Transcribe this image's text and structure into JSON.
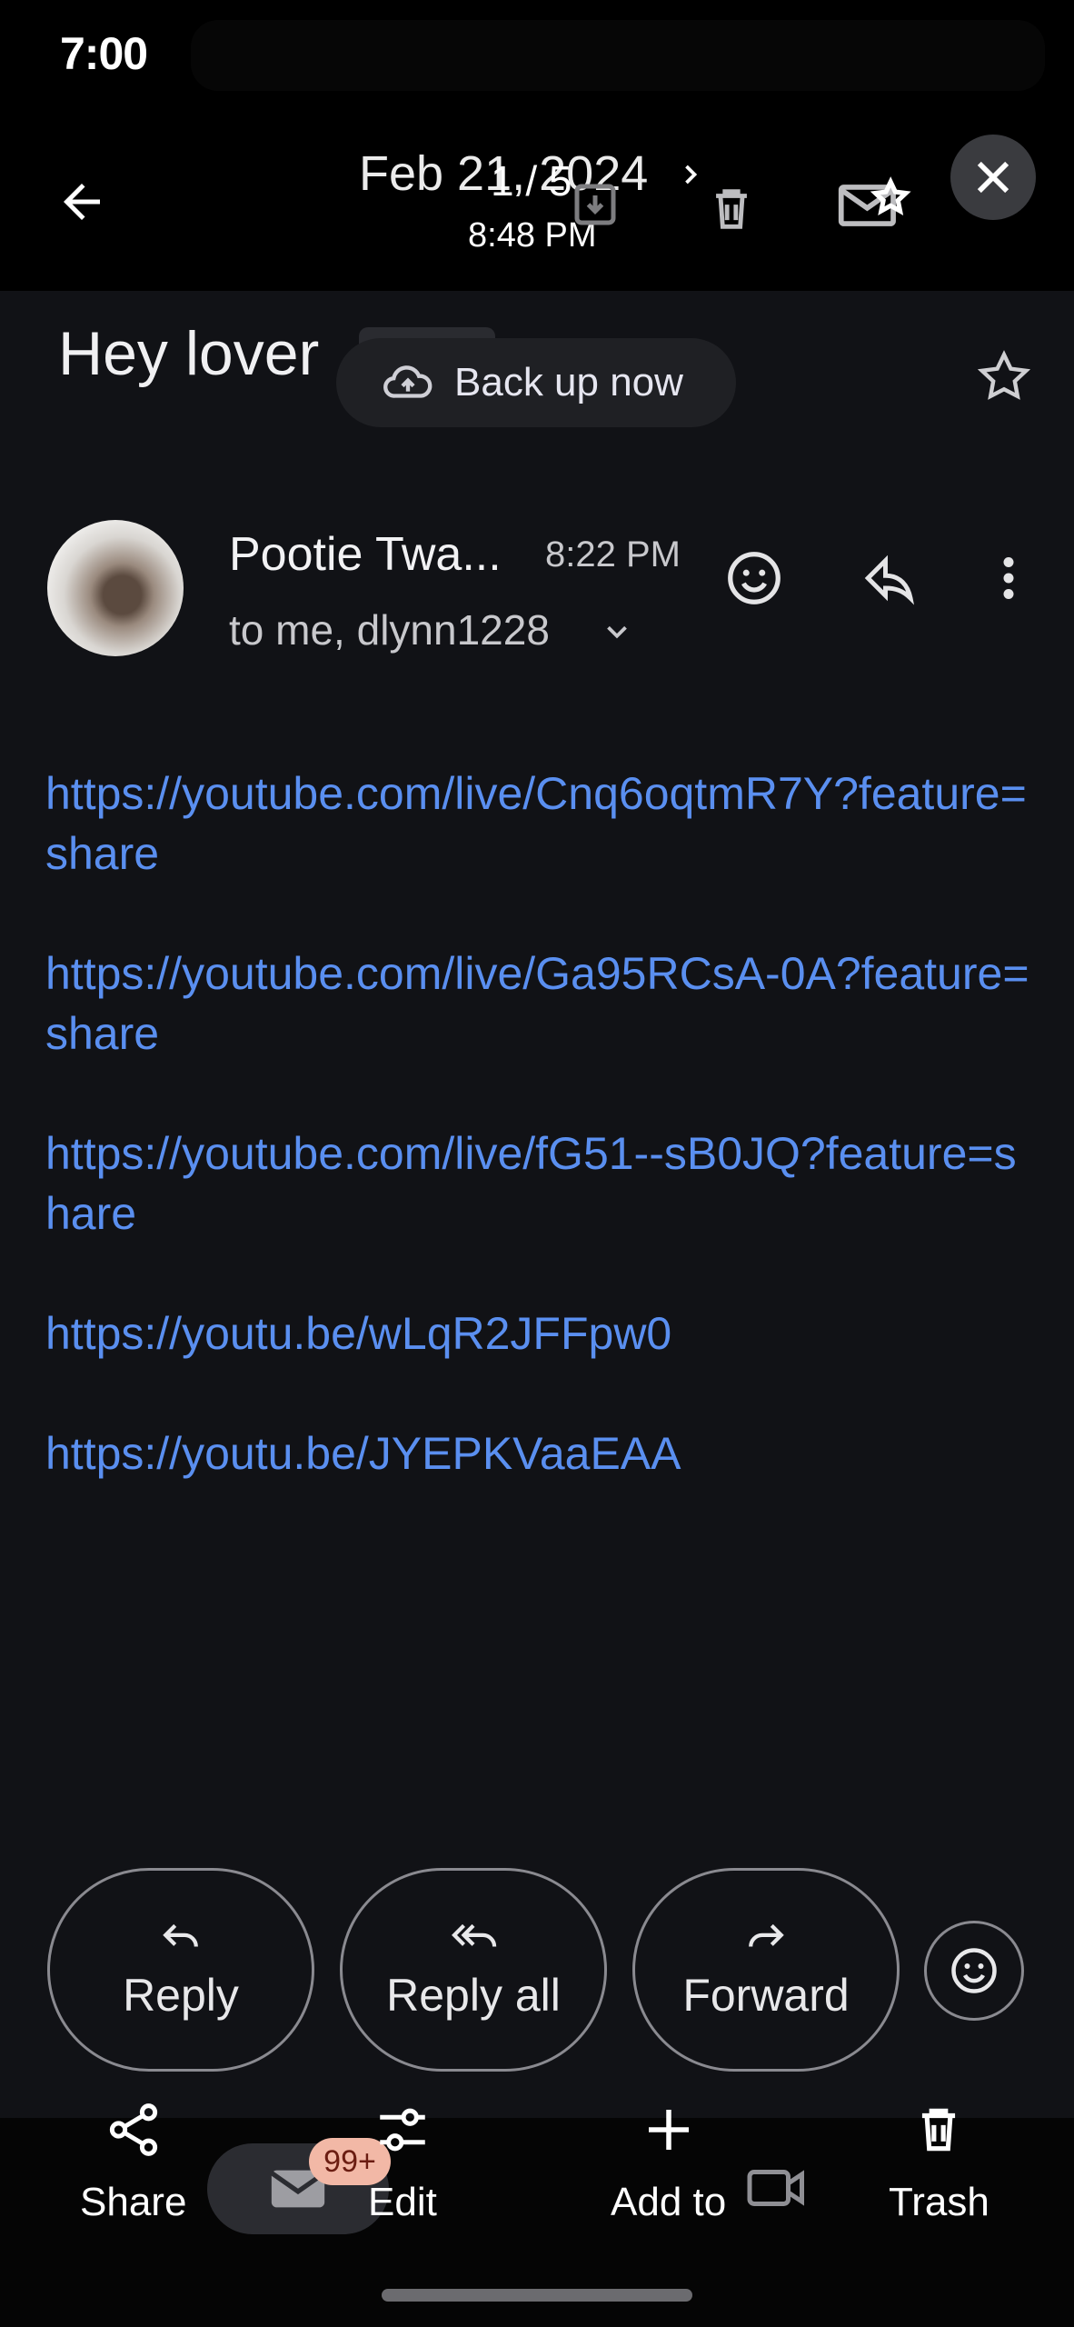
{
  "status": {
    "time": "7:00"
  },
  "viewer": {
    "date": "Feb 21, 2024",
    "counter": "1 / 5",
    "time": "8:48 PM"
  },
  "email": {
    "subject": "Hey lover",
    "backup_label": "Back up now",
    "sender": "Pootie Twa...",
    "sent_time": "8:22 PM",
    "recipients": "to me, dlynn1228",
    "links": [
      "https://youtube.com/live/Cnq6oqtmR7Y?feature=share",
      "https://youtube.com/live/Ga95RCsA-0A?feature=share",
      "https://youtube.com/live/fG51--sB0JQ?feature=share",
      "https://youtu.be/wLqR2JFFpw0",
      "https://youtu.be/JYEPKVaaEAA"
    ]
  },
  "actions": {
    "reply": "Reply",
    "reply_all": "Reply all",
    "forward": "Forward"
  },
  "toolbar": {
    "share": "Share",
    "edit": "Edit",
    "add_to": "Add to",
    "trash": "Trash",
    "badge": "99+"
  },
  "colors": {
    "link": "#5a8ff0",
    "background": "#111216",
    "badge": "#f2b8a6"
  }
}
